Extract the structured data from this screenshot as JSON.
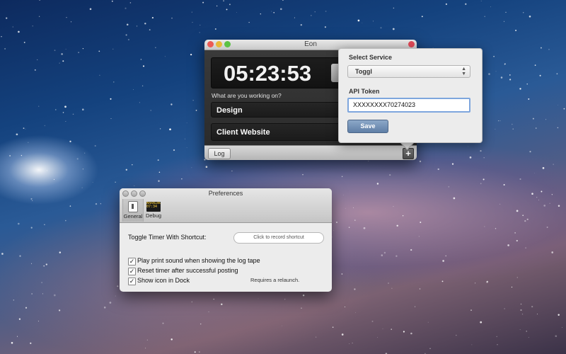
{
  "eon": {
    "title": "Eon",
    "timer": "05:23:53",
    "question": "What are you working on?",
    "project": "Design",
    "client": "Client Website",
    "log_label": "Log",
    "add_label": "+"
  },
  "popover": {
    "select_service_label": "Select Service",
    "service_value": "Toggl",
    "api_token_label": "API Token",
    "api_token_value": "XXXXXXXX70274023",
    "save_label": "Save"
  },
  "preferences": {
    "title": "Preferences",
    "toolbar": [
      {
        "label": "General",
        "icon": "general-switch-icon"
      },
      {
        "label": "Debug",
        "icon": "debug-console-icon"
      }
    ],
    "shortcut_label": "Toggle Timer With Shortcut:",
    "shortcut_placeholder": "Click to record shortcut",
    "options": [
      {
        "label": "Play print sound when showing the log tape",
        "checked": true
      },
      {
        "label": "Reset timer after successful posting",
        "checked": true
      },
      {
        "label": "Show icon in Dock",
        "checked": true
      }
    ],
    "relaunch_note": "Requires a relaunch."
  }
}
